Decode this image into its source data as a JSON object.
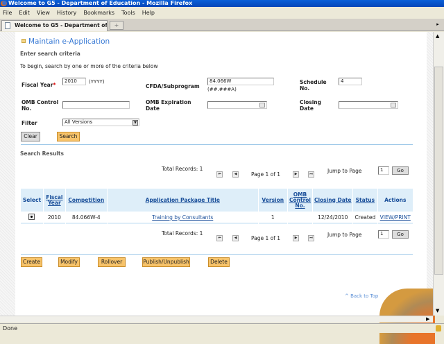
{
  "window": {
    "title": "Welcome to G5 - Department of Education - Mozilla Firefox"
  },
  "menu": [
    "File",
    "Edit",
    "View",
    "History",
    "Bookmarks",
    "Tools",
    "Help"
  ],
  "tab": {
    "label": "Welcome to G5 - Department of Edu...",
    "new_tab": "+"
  },
  "page": {
    "title": "Maintain e-Application",
    "section": "Enter search criteria",
    "instructions": "To begin, search by one or more of the criteria below",
    "form": {
      "fiscal_year_label": "Fiscal Year",
      "required_mark": "*",
      "fiscal_year_value": "2010",
      "fiscal_year_hint": "(YYYY)",
      "cfda_label": "CFDA/Subprogram",
      "cfda_value": "84.066W",
      "cfda_hint": "(##.###A)",
      "schedule_label": "Schedule No.",
      "schedule_value": "4",
      "omb_control_label": "OMB Control No.",
      "omb_control_value": "",
      "omb_exp_label": "OMB Expiration Date",
      "omb_exp_value": "",
      "closing_label": "Closing Date",
      "closing_value": "",
      "filter_label": "Filter",
      "filter_value": "All Versions",
      "clear": "Clear",
      "search": "Search"
    },
    "results_title": "Search Results",
    "pagination": {
      "total": "Total Records: 1",
      "page": "Page 1 of 1",
      "jump_label": "Jump to Page",
      "jump_value": "1",
      "go": "Go"
    },
    "table": {
      "headers": [
        "Select",
        "Fiscal Year",
        "Competition",
        "Application Package Title",
        "Version",
        "OMB Control No.",
        "Closing Date",
        "Status",
        "Actions"
      ],
      "rows": [
        {
          "selected": true,
          "fiscal_year": "2010",
          "competition": "84.066W-4",
          "title": "Training by Consultants",
          "version": "1",
          "omb": "",
          "closing": "12/24/2010",
          "status": "Created",
          "action": "VIEW/PRINT"
        }
      ]
    },
    "actions": [
      "Create",
      "Modify",
      "Rollover",
      "Publish/Unpublish",
      "Delete"
    ],
    "back_to_top": "^ Back to Top"
  },
  "status": {
    "text": "Done"
  },
  "colors": {
    "accent": "#3a7bd5",
    "button_orange": "#f7c36a",
    "header_bg": "#deeef9"
  }
}
